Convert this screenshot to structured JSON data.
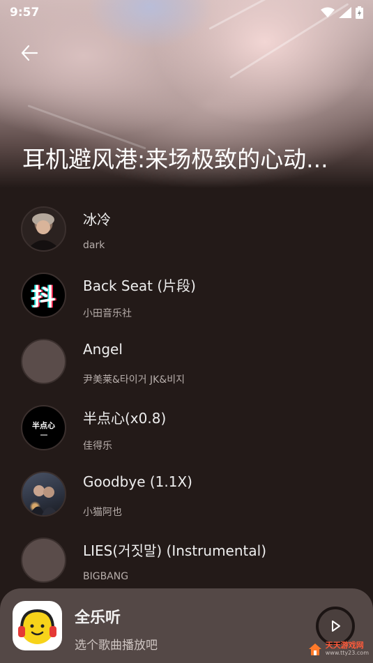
{
  "status": {
    "time": "9:57"
  },
  "playlist": {
    "title": "耳机避风港:来场极致的心动..."
  },
  "songs": [
    {
      "title": "冰冷",
      "artist": "dark",
      "thumb": "photo-person"
    },
    {
      "title": "Back Seat (片段)",
      "artist": "小田音乐社",
      "thumb": "douyin-logo",
      "thumb_text": "抖"
    },
    {
      "title": "Angel",
      "artist": "尹美莱&타이거 JK&비지",
      "thumb": "placeholder"
    },
    {
      "title": "半点心(x0.8)",
      "artist": "佳得乐",
      "thumb": "text-cover",
      "thumb_text": "半点心"
    },
    {
      "title": "Goodbye (1.1X)",
      "artist": "小猫阿也",
      "thumb": "photo-couple"
    },
    {
      "title": "LIES(거짓말) (Instrumental)",
      "artist": "BIGBANG",
      "thumb": "placeholder"
    }
  ],
  "mini_player": {
    "app_name": "全乐听",
    "prompt": "选个歌曲播放吧"
  },
  "watermark": {
    "name": "天天游戏网",
    "url": "www.tty23.com"
  },
  "colors": {
    "background": "#231a18",
    "mini_player_bg": "#544846",
    "placeholder_thumb": "#5a4c4a",
    "accent_yellow": "#f7d31a",
    "watermark_orange": "#ff5a3a"
  }
}
